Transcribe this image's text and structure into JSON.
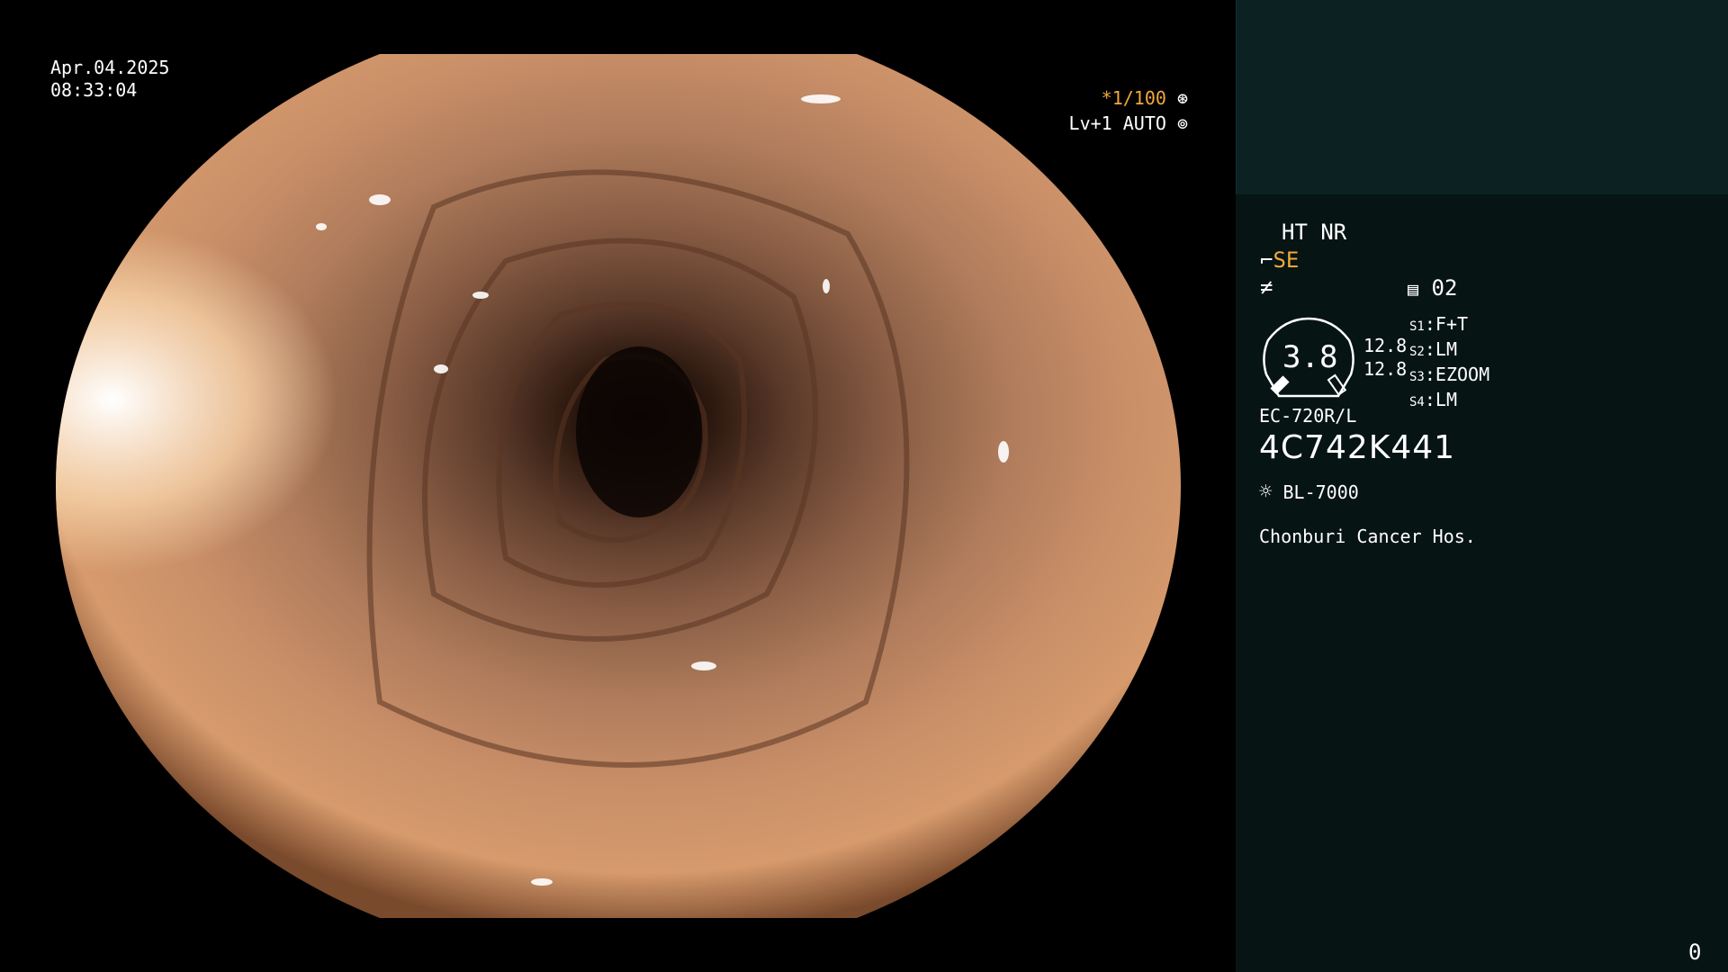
{
  "overlay": {
    "date": "Apr.04.2025",
    "time": "08:33:04",
    "shutter": "*1/100",
    "iris": "Lv+1 AUTO"
  },
  "panel": {
    "mode": "HT NR",
    "se_label": "SE",
    "record_icon_value": "02",
    "gauge_value": "3.8",
    "gauge_side_1": "12.8",
    "gauge_side_2": "12.8",
    "switches": [
      {
        "key": "S1",
        "value": "F+T"
      },
      {
        "key": "S2",
        "value": "LM"
      },
      {
        "key": "S3",
        "value": "EZOOM"
      },
      {
        "key": "S4",
        "value": "LM"
      }
    ],
    "scope_model": "EC-720R/L",
    "serial": "4C742K441",
    "light_source": "BL-7000",
    "hospital": "Chonburi Cancer Hos.",
    "counter": "0"
  },
  "icons": {
    "shutter_icon": "aperture-icon",
    "iris_icon": "iris-icon",
    "se_icon": "scope-tip-icon",
    "wave_icon": "not-equal-icon",
    "record_icon": "record-list-icon",
    "light_icon": "sun-icon"
  },
  "colors": {
    "panel_bg": "#071414",
    "panel_top_bg": "#0c2121",
    "accent": "#f2a83a"
  }
}
